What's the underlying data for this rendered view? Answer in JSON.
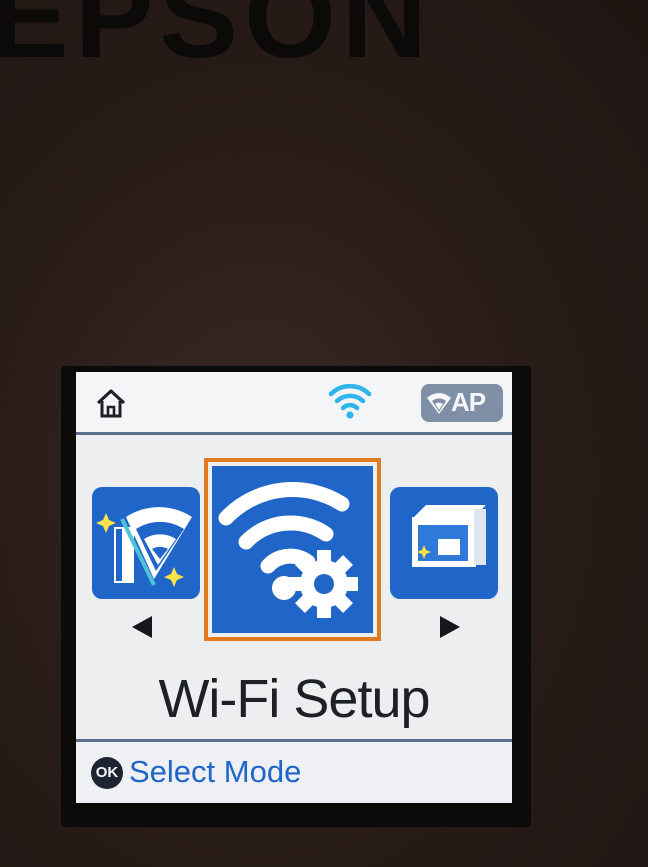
{
  "device": {
    "brand": "EPSON"
  },
  "statusbar": {
    "ap_label": "AP"
  },
  "carousel": {
    "selected_label": "Wi-Fi Setup"
  },
  "footer": {
    "ok_label": "OK",
    "hint": "Select Mode"
  },
  "colors": {
    "accent_blue": "#1f66c8",
    "selection_orange": "#e07b20",
    "screen_bg": "#edeef0",
    "status_gray": "#7f8fa6"
  }
}
